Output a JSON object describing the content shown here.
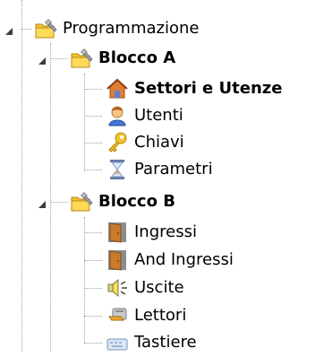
{
  "tree": {
    "root": {
      "label": "Programmazione",
      "icon": "folder-gear-icon",
      "expanded": true,
      "children": [
        {
          "label": "Blocco A",
          "icon": "folder-gear-icon",
          "bold": true,
          "expanded": true,
          "children": [
            {
              "label": "Settori e Utenze",
              "icon": "house-icon",
              "bold": true
            },
            {
              "label": "Utenti",
              "icon": "user-icon"
            },
            {
              "label": "Chiavi",
              "icon": "key-icon"
            },
            {
              "label": "Parametri",
              "icon": "hourglass-icon"
            }
          ]
        },
        {
          "label": "Blocco B",
          "icon": "folder-gear-icon",
          "bold": true,
          "expanded": true,
          "children": [
            {
              "label": "Ingressi",
              "icon": "door-icon"
            },
            {
              "label": "And Ingressi",
              "icon": "door-icon"
            },
            {
              "label": "Uscite",
              "icon": "speaker-icon"
            },
            {
              "label": "Lettori",
              "icon": "card-reader-icon"
            },
            {
              "label": "Tastiere",
              "icon": "keyboard-icon"
            }
          ]
        }
      ]
    }
  }
}
